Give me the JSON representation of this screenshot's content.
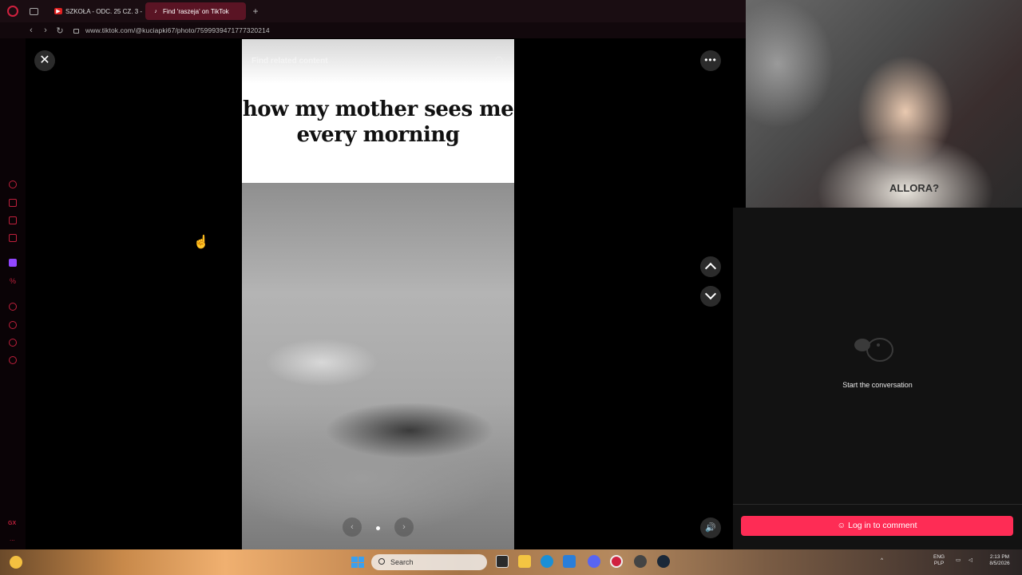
{
  "browser": {
    "tabs": [
      {
        "label": "SZKOŁA - ODC. 25 CZ. 3 -",
        "icon": "youtube-icon",
        "active": false
      },
      {
        "label": "Find 'raszeja' on TikTok",
        "icon": "tiktok-icon",
        "active": true
      }
    ],
    "new_tab": "+",
    "url": "www.tiktok.com/@kuciapki67/photo/7599939471777320214"
  },
  "sidebar": {
    "icons": [
      "chatgpt-icon",
      "bag-icon",
      "messenger-icon",
      "music-icon",
      "twitch-icon",
      "percent-icon",
      "play-icon",
      "history-icon",
      "chat-icon",
      "settings-icon"
    ],
    "gx_label": "GX",
    "more": "..."
  },
  "viewer": {
    "search_placeholder": "Find related content",
    "caption_line1": "how my mother sees me",
    "caption_line2": "every morning",
    "close": "✕",
    "more": "•••",
    "volume": "🔊",
    "prev": "‹",
    "next": "›"
  },
  "stream": {
    "shirt_text": "ALLORA?"
  },
  "comments": {
    "empty_text": "Start the conversation",
    "login_label": "Log in to comment",
    "accent": "#fe2c55"
  },
  "taskbar": {
    "search_label": "Search",
    "lang_line1": "ENG",
    "lang_line2": "PLP",
    "time": "2:13 PM",
    "date": "8/5/2026"
  }
}
